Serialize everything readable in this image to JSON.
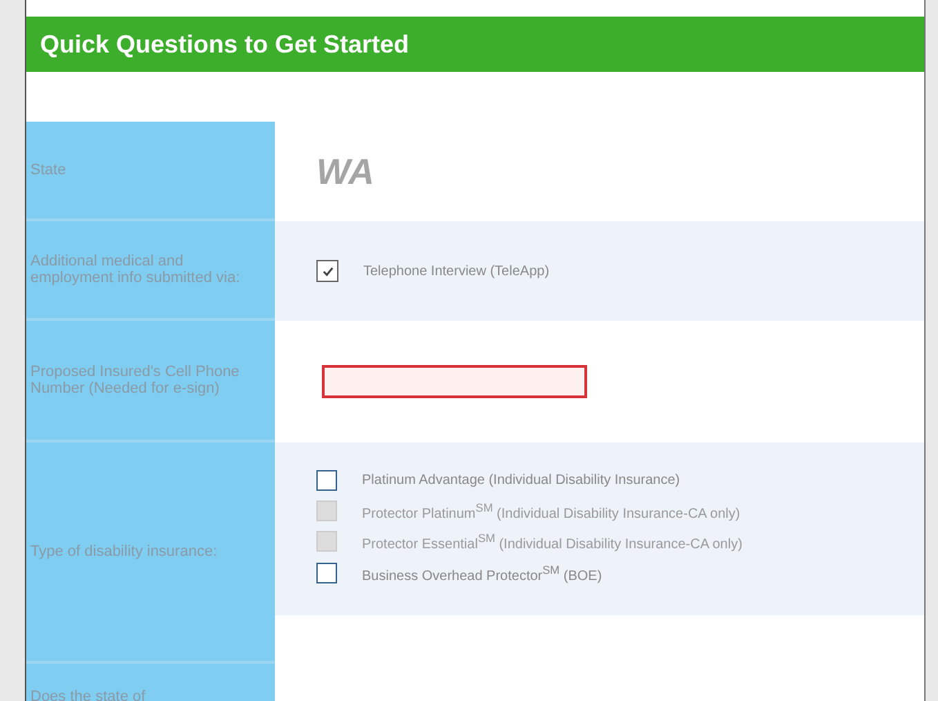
{
  "header": {
    "title": "Quick Questions to Get Started"
  },
  "rows": [
    {
      "kind": "value",
      "label": "State",
      "value": "WA"
    },
    {
      "kind": "checks",
      "label": "Additional medical and employment info submitted via:",
      "options": [
        {
          "label": "Telephone Interview (TeleApp)",
          "checked": true,
          "disabled": false
        }
      ]
    },
    {
      "kind": "input",
      "label": "Proposed Insured's Cell Phone Number (Needed for e-sign)",
      "invalid": true
    },
    {
      "kind": "checks",
      "label": "Type of disability insurance:",
      "options": [
        {
          "label": "Platinum Advantage (Individual Disability Insurance)",
          "checked": false,
          "disabled": false
        },
        {
          "label": "Protector Platinum$^{SM}$ (Individual Disability Insurance-CA only)",
          "checked": false,
          "disabled": true
        },
        {
          "label": "Protector Essential$^{SM}$ (Individual Disability Insurance-CA only)",
          "checked": false,
          "disabled": true
        },
        {
          "label": "Business Overhead Protector$^{SM}$ (BOE)",
          "checked": false,
          "disabled": false
        }
      ]
    },
    {
      "kind": "cut",
      "label": "Does the state of"
    }
  ]
}
